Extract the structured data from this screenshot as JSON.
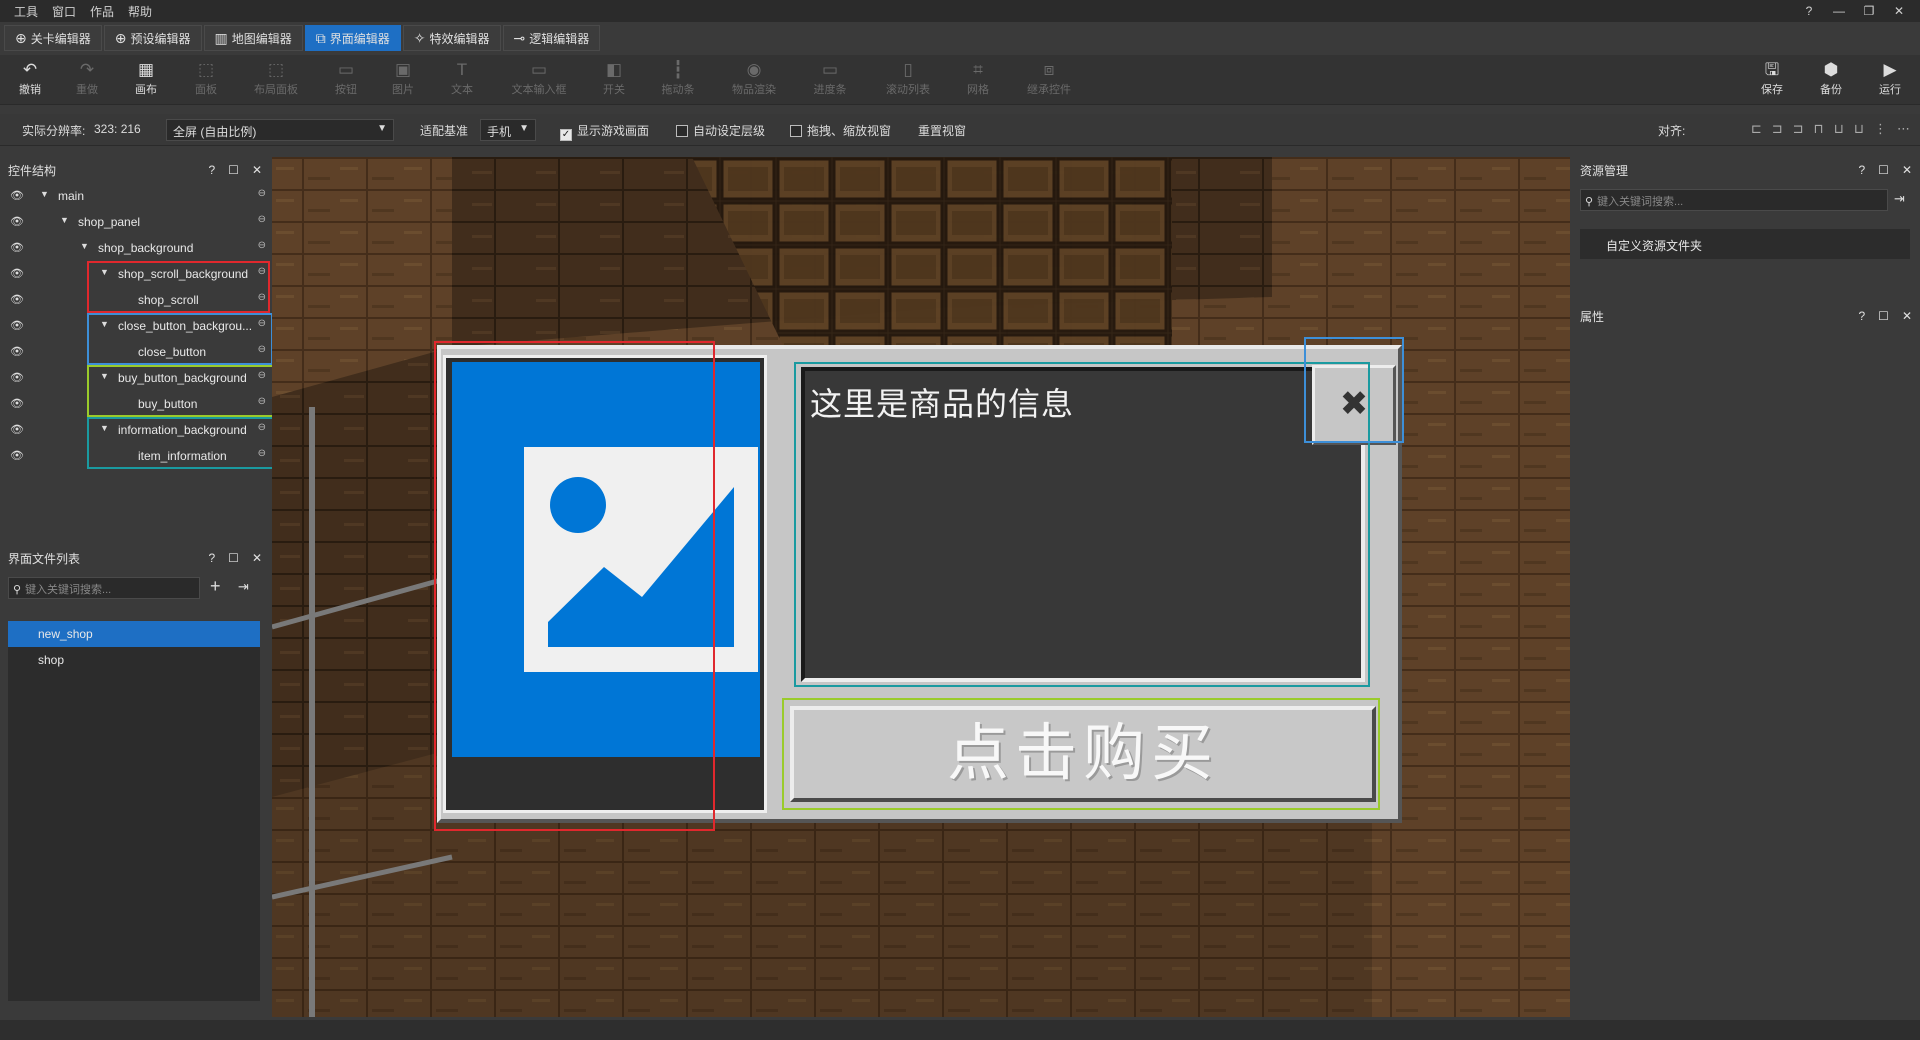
{
  "menubar": {
    "items": [
      "工具",
      "窗口",
      "作品",
      "帮助"
    ],
    "window_controls": [
      "?",
      "—",
      "❐",
      "✕"
    ]
  },
  "editor_tabs": [
    {
      "label": "关卡编辑器",
      "icon": "level-icon"
    },
    {
      "label": "预设编辑器",
      "icon": "preset-icon"
    },
    {
      "label": "地图编辑器",
      "icon": "map-icon"
    },
    {
      "label": "界面编辑器",
      "icon": "ui-icon",
      "active": true
    },
    {
      "label": "特效编辑器",
      "icon": "effects-icon"
    },
    {
      "label": "逻辑编辑器",
      "icon": "logic-icon"
    }
  ],
  "toolbar": {
    "undo": "撤销",
    "redo": "重做",
    "canvas": "画布",
    "panel": "面板",
    "layout_panel": "布局面板",
    "button": "按钮",
    "image": "图片",
    "text": "文本",
    "text_input": "文本输入框",
    "switch": "开关",
    "slider": "拖动条",
    "item_render": "物品渲染",
    "progress_bar": "进度条",
    "scroll_list": "滚动列表",
    "grid": "网格",
    "inherit_control": "继承控件",
    "save": "保存",
    "backup": "备份",
    "run": "运行"
  },
  "options": {
    "resolution_label": "实际分辨率:",
    "resolution_value": "323: 216",
    "screen_mode": "全屏 (自由比例)",
    "adapt_label": "适配基准",
    "adapt_value": "手机",
    "show_game_screen": "显示游戏画面",
    "auto_layer": "自动设定层级",
    "drag_zoom_view": "拖拽、缩放视窗",
    "reset_view": "重置视窗",
    "align_label": "对齐:"
  },
  "control_tree": {
    "title": "控件结构",
    "nodes": [
      {
        "name": "main"
      },
      {
        "name": "shop_panel"
      },
      {
        "name": "shop_background"
      },
      {
        "name": "shop_scroll_background"
      },
      {
        "name": "shop_scroll"
      },
      {
        "name": "close_button_backgrou..."
      },
      {
        "name": "close_button"
      },
      {
        "name": "buy_button_background"
      },
      {
        "name": "buy_button"
      },
      {
        "name": "information_background"
      },
      {
        "name": "item_information"
      }
    ]
  },
  "ui_files": {
    "title": "界面文件列表",
    "search_placeholder": "键入关键词搜索...",
    "files": [
      "new_shop",
      "shop"
    ]
  },
  "resources": {
    "title": "资源管理",
    "search_placeholder": "键入关键词搜索...",
    "folder": "自定义资源文件夹"
  },
  "properties": {
    "title": "属性"
  },
  "panel_controls": [
    "?",
    "☐",
    "✕"
  ],
  "shop_preview": {
    "info_text": "这里是商品的信息",
    "buy_label": "点击购买",
    "close_glyph": "✖"
  },
  "colors": {
    "accent": "#1e6fc4",
    "highlight_red": "#e0282d",
    "highlight_blue": "#3d8fd8",
    "highlight_green": "#9acb2b",
    "highlight_teal": "#1a9aa0"
  }
}
